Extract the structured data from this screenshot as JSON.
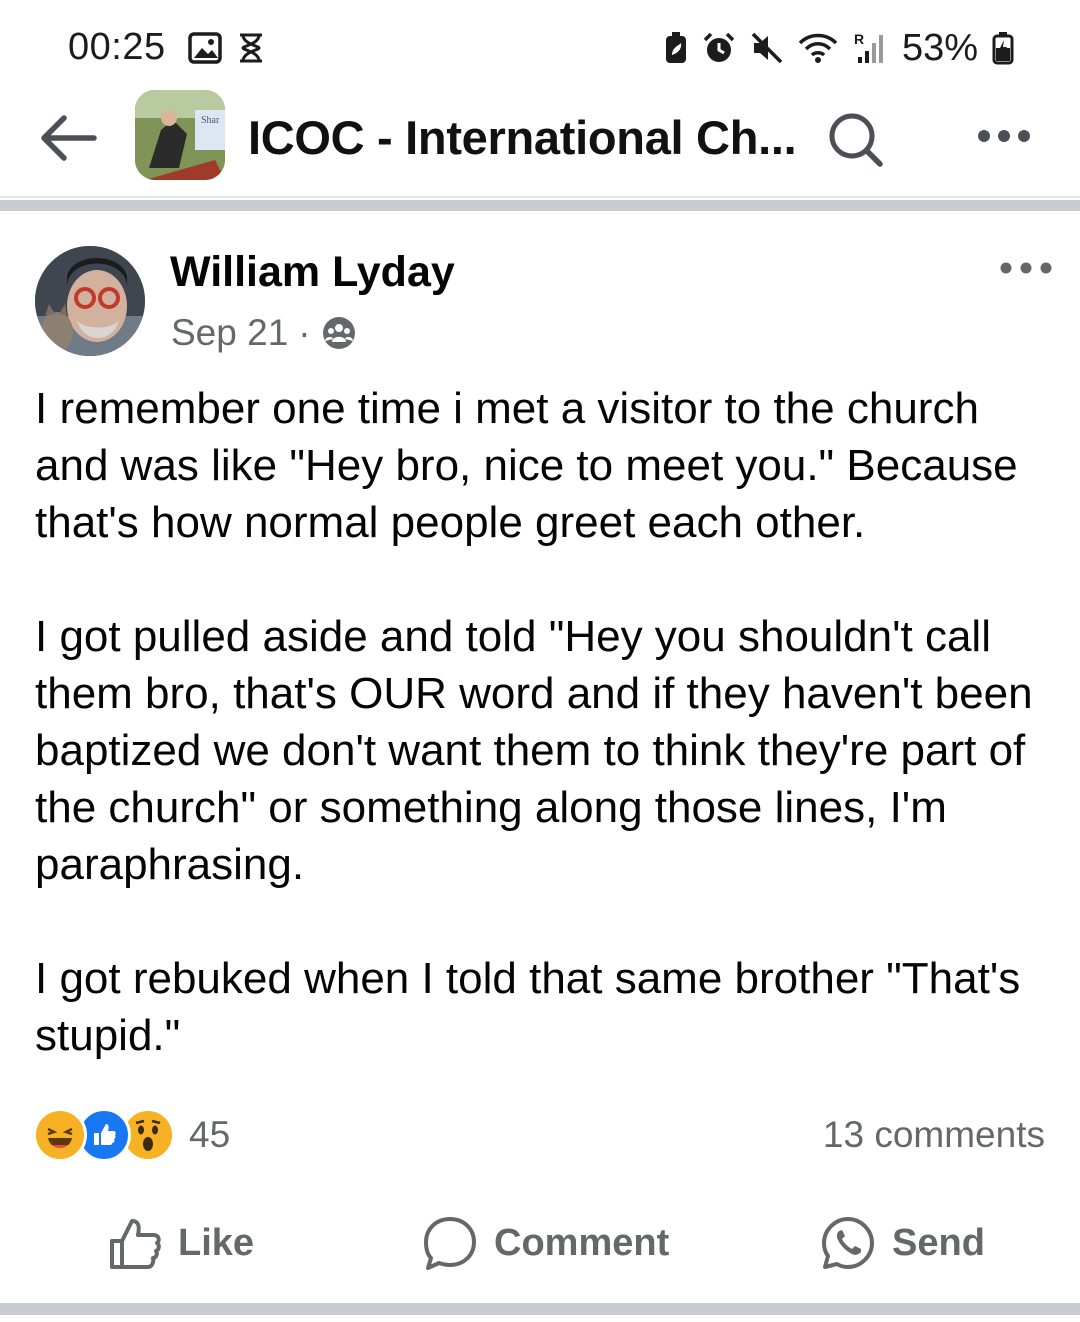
{
  "status_bar": {
    "time": "00:25",
    "battery": "53%",
    "icons": [
      "image-icon",
      "hourglass-icon",
      "battery-saver-icon",
      "alarm-icon",
      "mute-icon",
      "wifi-icon",
      "signal-icon",
      "battery-icon"
    ]
  },
  "header": {
    "title": "ICOC - International Ch...",
    "thumbnail_text": "Shar",
    "icons": [
      "back-arrow-icon",
      "search-icon",
      "more-icon"
    ]
  },
  "post": {
    "author": "William Lyday",
    "date": "Sep 21",
    "separator": "·",
    "audience_icon": "group-icon",
    "paragraphs": [
      "I remember one time i met a visitor to the church and was like \"Hey bro, nice to meet you.\" Because that's how normal people greet each other.",
      "I got pulled aside and told \"Hey you shouldn't call them bro, that's OUR word and if they haven't been baptized we don't want them to think they're part of the church\" or something along those lines, I'm paraphrasing.",
      "I got rebuked when I told that same brother \"That's stupid.\""
    ],
    "reactions": {
      "types": [
        "haha",
        "like",
        "wow"
      ],
      "count": "45"
    },
    "comments": "13 comments"
  },
  "actions": {
    "like": "Like",
    "comment": "Comment",
    "send": "Send"
  },
  "colors": {
    "text": "#050505",
    "secondary": "#65676b",
    "like_blue": "#1877f2",
    "reaction_yellow": "#f7b125",
    "divider": "#c9ccd1"
  }
}
